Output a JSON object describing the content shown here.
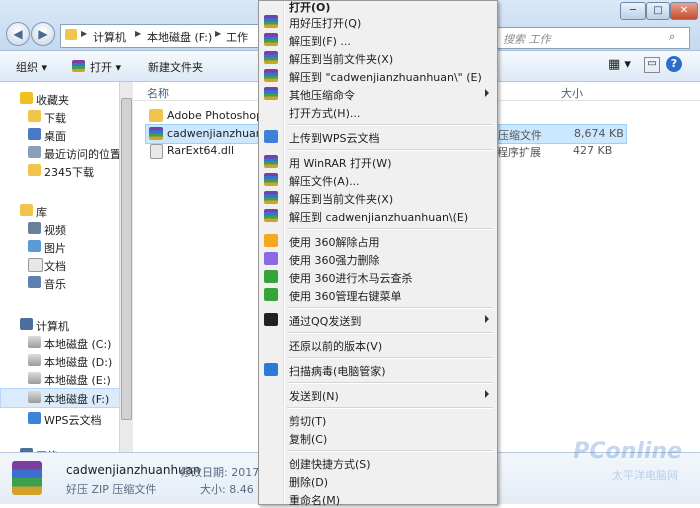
{
  "window_controls": {
    "minimize": "─",
    "maximize": "□",
    "close": "✕"
  },
  "address": {
    "crumbs": [
      "计算机",
      "本地磁盘 (F:)",
      "工作"
    ]
  },
  "search": {
    "placeholder": "搜索 工作"
  },
  "toolbar": {
    "organize": "组织",
    "open": "打开",
    "new_folder": "新建文件夹"
  },
  "nav": {
    "favorites": "收藏夹",
    "downloads": "下载",
    "desktop": "桌面",
    "recent": "最近访问的位置",
    "downloads2345": "2345下载",
    "libraries": "库",
    "videos": "视频",
    "pictures": "图片",
    "documents": "文档",
    "music": "音乐",
    "computer": "计算机",
    "drive_c": "本地磁盘 (C:)",
    "drive_d": "本地磁盘 (D:)",
    "drive_e": "本地磁盘 (E:)",
    "drive_f": "本地磁盘 (F:)",
    "wps": "WPS云文档",
    "network": "网络"
  },
  "columns": {
    "name": "名称",
    "size": "大小"
  },
  "files": [
    {
      "name": "Adobe Photoshop C",
      "type": "",
      "size": ""
    },
    {
      "name": "cadwenjianzhuanhuan",
      "type": "压缩文件",
      "size": "8,674 KB"
    },
    {
      "name": "RarExt64.dll",
      "type": "程序扩展",
      "size": "427 KB"
    }
  ],
  "details": {
    "name": "cadwenjianzhuanhuan",
    "modified": "修改日期: 2017/9",
    "type": "好压 ZIP 压缩文件",
    "size": "大小: 8.46 M"
  },
  "watermark": {
    "brand": "PConline",
    "sub": "太平洋电脑网"
  },
  "menu": {
    "open": "打开(O)",
    "haozip_open": "用好压打开(Q)",
    "extract_to": "解压到(F) ...",
    "extract_here": "解压到当前文件夹(X)",
    "extract_named": "解压到 \"cadwenjianzhuanhuan\\\" (E)",
    "other_compress": "其他压缩命令",
    "open_with": "打开方式(H)...",
    "upload_wps": "上传到WPS云文档",
    "winrar_open": "用 WinRAR 打开(W)",
    "extract_files": "解压文件(A)...",
    "extract_here2": "解压到当前文件夹(X)",
    "extract_named2": "解压到 cadwenjianzhuanhuan\\(E)",
    "unlock360": "使用 360解除占用",
    "forcedel360": "使用 360强力删除",
    "scan360": "使用 360进行木马云查杀",
    "manage360": "使用 360管理右键菜单",
    "qq_send": "通过QQ发送到",
    "restore": "还原以前的版本(V)",
    "scan_virus": "扫描病毒(电脑管家)",
    "send_to": "发送到(N)",
    "cut": "剪切(T)",
    "copy": "复制(C)",
    "shortcut": "创建快捷方式(S)",
    "delete": "删除(D)",
    "rename": "重命名(M)"
  }
}
